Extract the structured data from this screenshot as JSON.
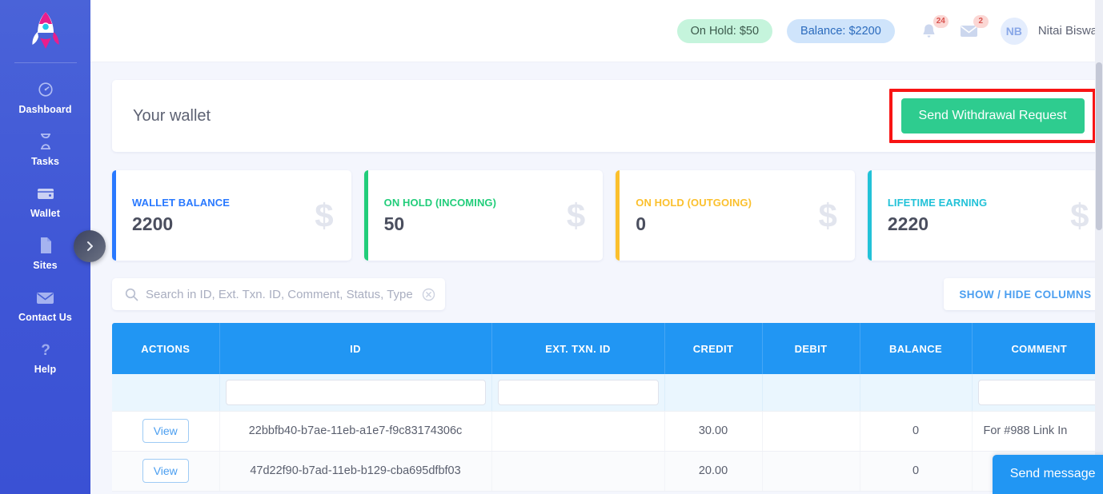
{
  "sidebar": {
    "logo_icon": "rocket-icon",
    "items": [
      {
        "label": "Dashboard",
        "icon": "speedometer-icon"
      },
      {
        "label": "Tasks",
        "icon": "hourglass-icon"
      },
      {
        "label": "Wallet",
        "icon": "wallet-icon"
      },
      {
        "label": "Sites",
        "icon": "document-icon"
      },
      {
        "label": "Contact Us",
        "icon": "envelope-icon"
      },
      {
        "label": "Help",
        "icon": "question-mark-icon"
      }
    ],
    "collapse_icon": "chevron-right-icon"
  },
  "topbar": {
    "on_hold_pill": "On Hold: $50",
    "balance_pill": "Balance: $2200",
    "notifications_badge": "24",
    "messages_badge": "2",
    "avatar_initials": "NB",
    "username": "Nitai Biswas"
  },
  "wallet": {
    "title": "Your wallet",
    "withdraw_button": "Send Withdrawal Request",
    "highlight_color": "#f81414"
  },
  "stats": [
    {
      "label": "WALLET BALANCE",
      "value": "2200",
      "color": "#2979ff",
      "symbol": "$"
    },
    {
      "label": "ON HOLD (INCOMING)",
      "value": "50",
      "color": "#21cd7a",
      "symbol": "$"
    },
    {
      "label": "ON HOLD (OUTGOING)",
      "value": "0",
      "color": "#fbc02d",
      "symbol": "$"
    },
    {
      "label": "LIFETIME EARNING",
      "value": "2220",
      "color": "#22c2d8",
      "symbol": "$"
    }
  ],
  "toolbar": {
    "search_placeholder": "Search in ID, Ext. Txn. ID, Comment, Status, Type",
    "search_value": "",
    "search_icon": "search-icon",
    "clear_icon": "clear-circle-icon",
    "columns_button": "SHOW / HIDE COLUMNS"
  },
  "table": {
    "headers": [
      "ACTIONS",
      "ID",
      "EXT. TXN. ID",
      "CREDIT",
      "DEBIT",
      "BALANCE",
      "COMMENT"
    ],
    "filters": [
      "",
      "",
      "",
      "",
      "",
      "",
      ""
    ],
    "rows": [
      {
        "action": "View",
        "id": "22bbfb40-b7ae-11eb-a1e7-f9c83174306c",
        "ext_txn_id": "",
        "credit": "30.00",
        "debit": "",
        "balance": "0",
        "comment": "For #988 Link In"
      },
      {
        "action": "View",
        "id": "47d22f90-b7ad-11eb-b129-cba695dfbf03",
        "ext_txn_id": "",
        "credit": "20.00",
        "debit": "",
        "balance": "0",
        "comment": ""
      }
    ]
  },
  "chat": {
    "label": "Send message"
  }
}
